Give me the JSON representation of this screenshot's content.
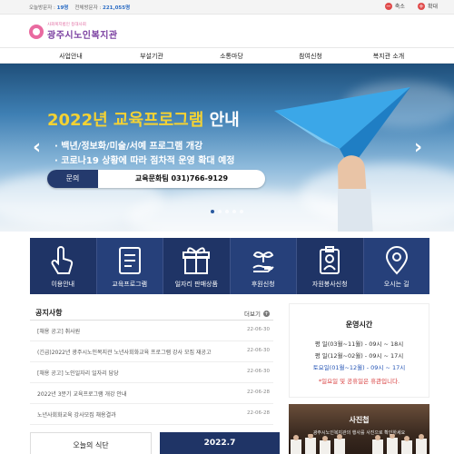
{
  "topbar": {
    "today_label": "오늘방문자 :",
    "today_value": "19명",
    "total_label": "전체방문자 :",
    "total_value": "221,055명",
    "zoom_out": "축소",
    "zoom_in": "확대"
  },
  "logo": {
    "subtitle": "사회복지법인 등대사회",
    "title": "광주시노인복지관"
  },
  "gnb": [
    {
      "label": "사업안내"
    },
    {
      "label": "부설기관"
    },
    {
      "label": "소통마당"
    },
    {
      "label": "참여신청"
    },
    {
      "label": "복지관 소개"
    }
  ],
  "hero": {
    "title_highlight": "2022년 교육프로그램",
    "title_rest": " 안내",
    "line1": "· 백년/정보화/미술/서예 프로그램 개강",
    "line2": "· 코로나19 상황에 따라 점차적 운영 확대 예정",
    "contact_label": "문의",
    "contact_value": "교육문화팀 031)766-9129",
    "prev": "‹",
    "next": "›",
    "active_slide_index": 0,
    "slide_count": 5
  },
  "quick_menu": [
    {
      "label": "이용안내",
      "icon": "hand-pointer-icon"
    },
    {
      "label": "교육프로그램",
      "icon": "document-icon"
    },
    {
      "label": "일자리 판매상품",
      "icon": "gift-box-icon"
    },
    {
      "label": "후원신청",
      "icon": "plant-hand-icon"
    },
    {
      "label": "자원봉사신청",
      "icon": "id-badge-icon"
    },
    {
      "label": "오시는 길",
      "icon": "map-pin-icon"
    }
  ],
  "notice": {
    "title": "공지사항",
    "more": "더보기",
    "items": [
      {
        "title": "[채용 공고] 취사원",
        "date": "22-06-30"
      },
      {
        "title": "(긴급)2022년 광주시노인복지관 노년사회화교육 프로그램 강사 모집 재공고",
        "date": "22-06-30"
      },
      {
        "title": "[채용 공고] 노인일자리 일자리 담당",
        "date": "22-06-30"
      },
      {
        "title": "2022년 3분기 교육프로그램 개강 안내",
        "date": "22-06-28"
      },
      {
        "title": "노년사회화교육 강사모집 채용결과",
        "date": "22-06-28"
      }
    ]
  },
  "hours": {
    "title": "운영시간",
    "line1": "평 일(03월~11월) - 09시 ~ 18시",
    "line2": "평 일(12월~02월) - 09시 ~ 17시",
    "line3": "토요일(01월~12월) - 09시 ~ 17시",
    "note": "*일요일 및 공휴일은 휴관입니다."
  },
  "photo": {
    "title": "사진첩",
    "subtitle": "광주시노인복지관의 행사를 사진으로 확인하세요"
  },
  "bottom": {
    "meal_title": "오늘의 식단",
    "month": "2022.7"
  },
  "colors": {
    "navy": "#1f3466",
    "accent_yellow": "#f4d233",
    "red": "#d73a3a",
    "blue": "#2454b5"
  }
}
